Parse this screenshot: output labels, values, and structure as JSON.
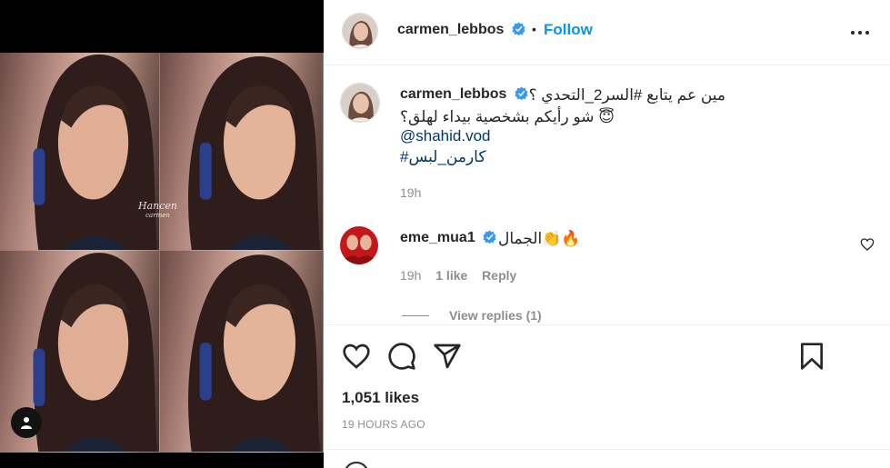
{
  "post": {
    "author": "carmen_lebbos",
    "follow_label": "Follow",
    "separator": "•",
    "media_watermark": "Hancen",
    "media_watermark_sub": "carmen"
  },
  "caption": {
    "username": "carmen_lebbos",
    "line1": "مين عم يتابع #السر2_التحدي ؟",
    "line2": "شو رأيكم بشخصية بيداء لهلق؟ 😇",
    "mention": "@shahid.vod",
    "hashtag": "#كارمن_لبس",
    "time": "19h"
  },
  "comment": {
    "username": "eme_mua1",
    "text": "الجمال👏🔥",
    "time": "19h",
    "likes": "1 like",
    "reply_label": "Reply",
    "view_replies": "View replies (1)"
  },
  "stats": {
    "likes": "1,051 likes",
    "posted": "19 HOURS AGO"
  },
  "colors": {
    "accent": "#0095f6",
    "verified": "#3897f0",
    "link": "#00376b",
    "muted": "#8e8e8e",
    "text": "#262626"
  },
  "icons": [
    "verified-badge-icon",
    "more-options-icon",
    "heart-icon",
    "comment-icon",
    "share-icon",
    "save-bookmark-icon",
    "user-tag-icon"
  ]
}
